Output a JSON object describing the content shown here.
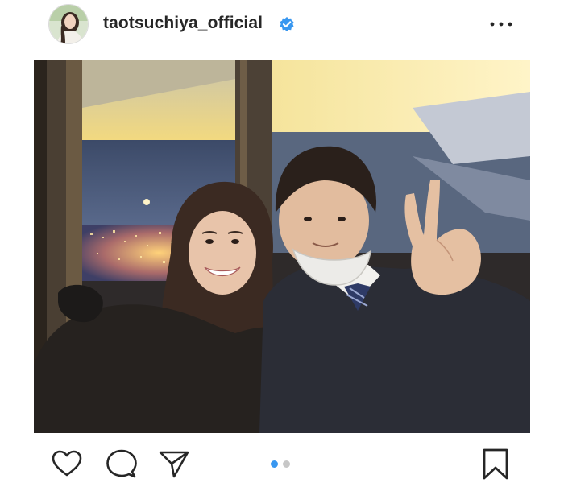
{
  "post": {
    "username": "taotsuchiya_official",
    "verified": true,
    "avatar_icon": "profile-photo",
    "more_icon": "more-horizontal-icon",
    "photo_description_icon": "selfie-photo"
  },
  "actions": {
    "like_icon": "heart-icon",
    "comment_icon": "comment-icon",
    "share_icon": "paper-plane-icon",
    "save_icon": "bookmark-icon"
  },
  "carousel": {
    "total_slides": 2,
    "active_slide": 1
  },
  "colors": {
    "text": "#262626",
    "verified_blue": "#3897f0",
    "dot_active": "#3897f0",
    "dot_inactive": "#c7c7c7",
    "icon_stroke": "#262626"
  }
}
